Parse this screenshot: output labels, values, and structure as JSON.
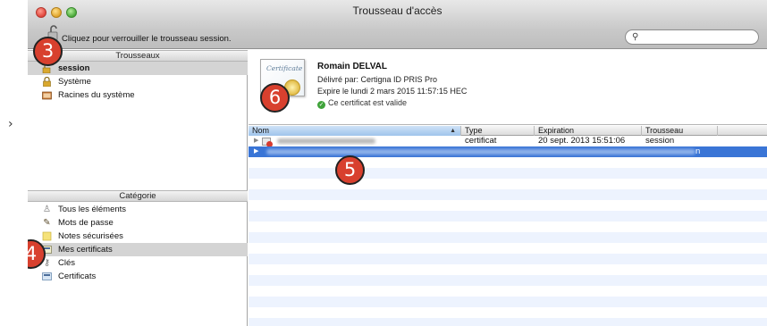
{
  "page": {
    "nav_chevron": "›"
  },
  "window": {
    "title": "Trousseau d'accès",
    "lock_text": "Cliquez pour verrouiller le trousseau session.",
    "search": {
      "placeholder": "",
      "value": ""
    }
  },
  "sidebar": {
    "keychains_header": "Trousseaux",
    "keychains": [
      {
        "label": "session",
        "icon": "unlocked-padlock-icon",
        "selected": true
      },
      {
        "label": "Système",
        "icon": "padlock-icon",
        "selected": false
      },
      {
        "label": "Racines du système",
        "icon": "folder-icon",
        "selected": false
      }
    ],
    "category_header": "Catégorie",
    "categories": [
      {
        "label": "Tous les éléments",
        "icon": "people-icon",
        "selected": false
      },
      {
        "label": "Mots de passe",
        "icon": "pencil-icon",
        "selected": false
      },
      {
        "label": "Notes sécurisées",
        "icon": "note-icon",
        "selected": false
      },
      {
        "label": "Mes certificats",
        "icon": "certificate-icon",
        "selected": true
      },
      {
        "label": "Clés",
        "icon": "key-icon",
        "selected": false
      },
      {
        "label": "Certificats",
        "icon": "certificate-icon",
        "selected": false
      }
    ]
  },
  "certificate": {
    "thumbnail_script": "Certificate",
    "name": "Romain DELVAL",
    "issuer": "Délivré par: Certigna ID PRIS Pro",
    "expiry": "Expire le lundi 2 mars 2015 11:57:15 HEC",
    "status": "Ce certificat est valide",
    "status_color": "#3fa33a"
  },
  "table": {
    "columns": [
      "Nom",
      "Type",
      "Expiration",
      "Trousseau"
    ],
    "sorted_column": "Nom",
    "rows": [
      {
        "name": "",
        "type": "certificat",
        "expiration": "20 sept. 2013 15:51:06",
        "keychain": "session",
        "selected": false
      },
      {
        "name": "",
        "type": "",
        "expiration": "",
        "keychain": "n",
        "selected": true
      }
    ],
    "selection_color": "#3a75d6"
  },
  "annotations": [
    "3",
    "4",
    "5",
    "6"
  ]
}
